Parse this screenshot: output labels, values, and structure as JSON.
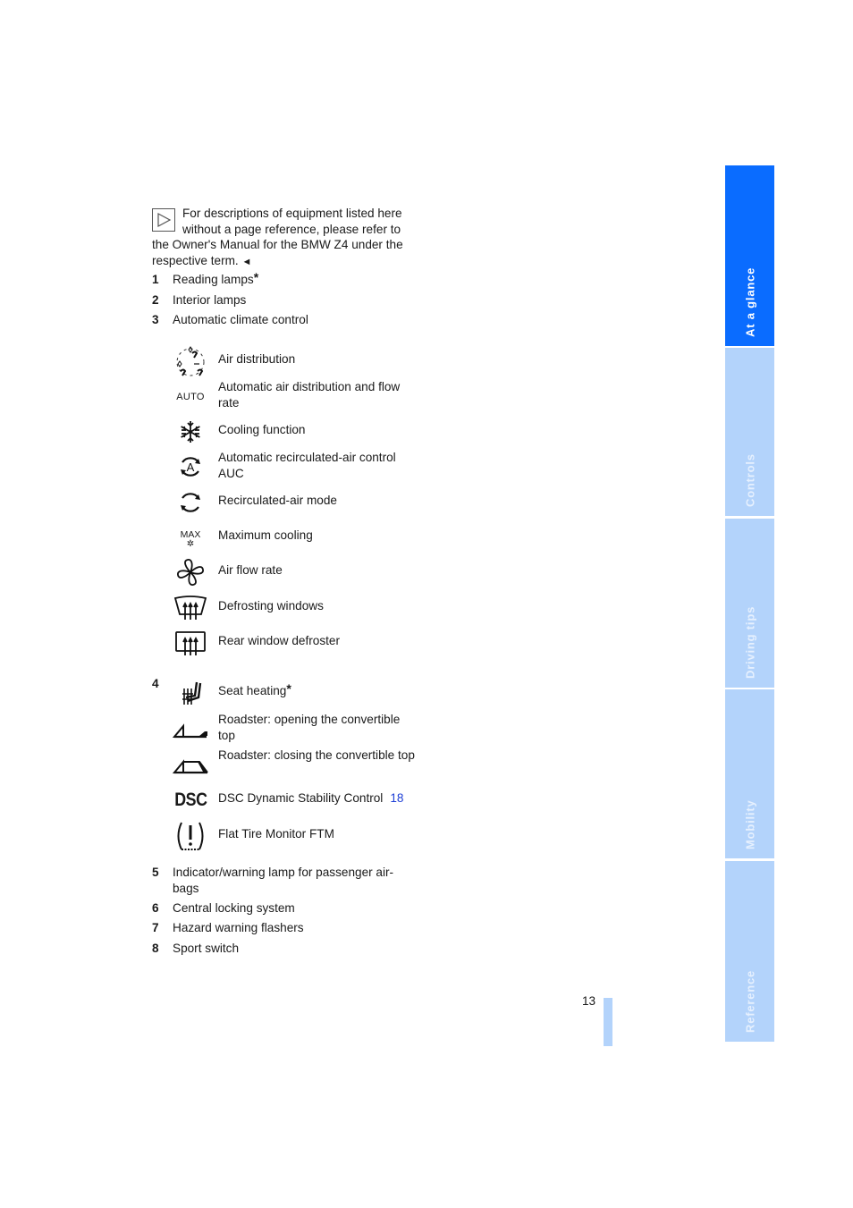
{
  "note": {
    "icon": "triangle-play-note-icon",
    "text": "For descriptions of equipment listed here without a page reference, please refer to the Owner's Manual for the BMW Z4 under the respective term.",
    "end_marker": "◄"
  },
  "items": [
    {
      "number": "1",
      "label": "Reading lamps",
      "star": "*"
    },
    {
      "number": "2",
      "label": "Interior lamps"
    },
    {
      "number": "3",
      "label": "Automatic climate control"
    }
  ],
  "climate_controls": [
    {
      "icon": "air-distribution-icon",
      "label": "Air distribution"
    },
    {
      "icon": "auto-icon",
      "icon_text": "AUTO",
      "label": "Automatic air distribution and flow rate"
    },
    {
      "icon": "snowflake-icon",
      "label": "Cooling function"
    },
    {
      "icon": "auc-recirculation-icon",
      "icon_text": "A",
      "label": "Automatic recirculated-air control AUC"
    },
    {
      "icon": "recirculation-icon",
      "label": "Recirculated-air mode"
    },
    {
      "icon": "max-cooling-icon",
      "icon_text": "MAX",
      "label": "Maximum cooling"
    },
    {
      "icon": "fan-icon",
      "label": "Air flow rate"
    },
    {
      "icon": "windshield-defrost-icon",
      "label": "Defrosting windows"
    },
    {
      "icon": "rear-window-defrost-icon",
      "label": "Rear window defroster"
    }
  ],
  "item4": {
    "number": "4",
    "controls": [
      {
        "icon": "seat-heating-icon",
        "label": "Seat heating",
        "star": "*"
      },
      {
        "icon": "roof-open-icon",
        "label": "Roadster: opening the convertible top"
      },
      {
        "icon": "roof-close-icon",
        "label": "Roadster: closing the convertible top"
      },
      {
        "icon": "dsc-icon",
        "icon_text": "DSC",
        "label": "DSC Dynamic Stability Control",
        "page_ref": "18"
      },
      {
        "icon": "flat-tire-monitor-icon",
        "icon_text": "!",
        "label": "Flat Tire Monitor FTM"
      }
    ]
  },
  "items_after": [
    {
      "number": "5",
      "label": "Indicator/warning lamp for passenger airbags",
      "label_display": "Indicator/warning lamp for passenger air-bags"
    },
    {
      "number": "6",
      "label": "Central locking system"
    },
    {
      "number": "7",
      "label": "Hazard warning flashers"
    },
    {
      "number": "8",
      "label": "Sport switch"
    }
  ],
  "side_tabs": [
    {
      "label": "At a glance",
      "active": true
    },
    {
      "label": "Controls",
      "active": false
    },
    {
      "label": "Driving tips",
      "active": false
    },
    {
      "label": "Mobility",
      "active": false
    },
    {
      "label": "Reference",
      "active": false
    }
  ],
  "colors": {
    "active_tab": "#0a6cff",
    "inactive_tab": "#b3d3fb",
    "page_ref": "#1e3fd6"
  },
  "page_number": "13"
}
